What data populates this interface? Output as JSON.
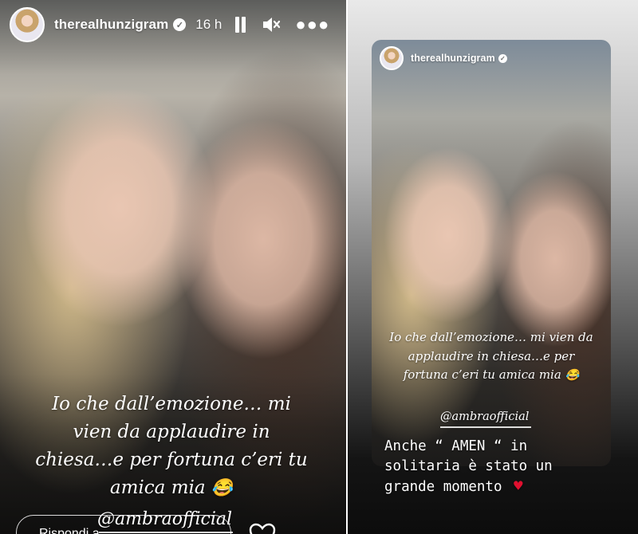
{
  "left_story": {
    "username": "therealhunzigram",
    "verified_mark": "✓",
    "time": "16 h",
    "icons": {
      "pause": "pause-icon",
      "mute": "mute-icon",
      "more": "more-options-icon",
      "like": "heart-icon"
    },
    "caption": "Io che dall’emozione… mi vien da applaudire in chiesa…e per fortuna c’eri tu amica mia",
    "caption_emoji": "😂",
    "mention": "@ambraofficial",
    "reply_placeholder": "Rispondi a..."
  },
  "right_story": {
    "username": "therealhunzigram",
    "verified_mark": "✓",
    "inner_caption": "Io che dall’emozione… mi vien da applaudire in chiesa…e per fortuna c’eri tu amica mia",
    "inner_caption_emoji": "😂",
    "inner_mention": "@ambraofficial",
    "repost_line1": "Anche “ AMEN “ in",
    "repost_line2": "solitaria è stato un",
    "repost_line3": "grande momento",
    "repost_heart": "♥"
  },
  "colors": {
    "heart_red": "#e0102f",
    "divider": "#ffffff"
  }
}
